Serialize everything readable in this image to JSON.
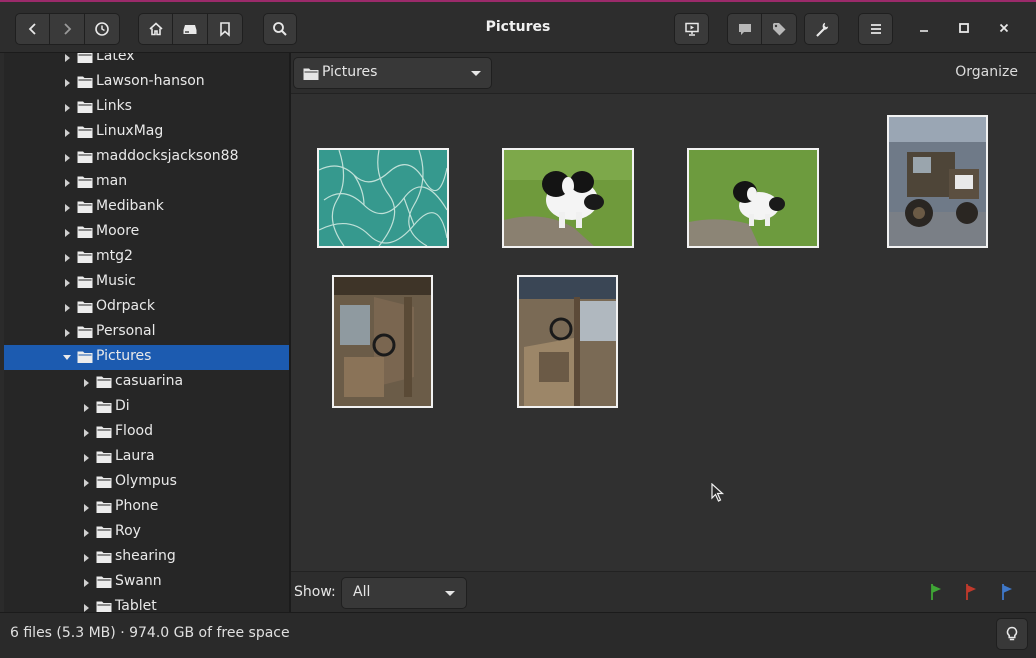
{
  "window": {
    "title": "Pictures"
  },
  "header": {
    "icons": [
      "back-icon",
      "forward-icon",
      "history-icon",
      "home-icon",
      "drive-icon",
      "bookmark-icon",
      "search-icon",
      "slideshow-icon",
      "comment-icon",
      "tag-icon",
      "tools-icon",
      "menu-icon",
      "minimize-icon",
      "maximize-icon",
      "close-icon"
    ]
  },
  "sidebar": {
    "items": [
      {
        "label": "Latex",
        "level": 0,
        "expanded": false,
        "selected": false
      },
      {
        "label": "Lawson-hanson",
        "level": 0,
        "expanded": false,
        "selected": false
      },
      {
        "label": "Links",
        "level": 0,
        "expanded": false,
        "selected": false
      },
      {
        "label": "LinuxMag",
        "level": 0,
        "expanded": false,
        "selected": false
      },
      {
        "label": "maddocksjackson88",
        "level": 0,
        "expanded": false,
        "selected": false
      },
      {
        "label": "man",
        "level": 0,
        "expanded": false,
        "selected": false
      },
      {
        "label": "Medibank",
        "level": 0,
        "expanded": false,
        "selected": false
      },
      {
        "label": "Moore",
        "level": 0,
        "expanded": false,
        "selected": false
      },
      {
        "label": "mtg2",
        "level": 0,
        "expanded": false,
        "selected": false
      },
      {
        "label": "Music",
        "level": 0,
        "expanded": false,
        "selected": false
      },
      {
        "label": "Odrpack",
        "level": 0,
        "expanded": false,
        "selected": false
      },
      {
        "label": "Personal",
        "level": 0,
        "expanded": false,
        "selected": false
      },
      {
        "label": "Pictures",
        "level": 0,
        "expanded": true,
        "selected": true
      },
      {
        "label": "casuarina",
        "level": 1,
        "expanded": false,
        "selected": false
      },
      {
        "label": "Di",
        "level": 1,
        "expanded": false,
        "selected": false
      },
      {
        "label": "Flood",
        "level": 1,
        "expanded": false,
        "selected": false
      },
      {
        "label": "Laura",
        "level": 1,
        "expanded": false,
        "selected": false
      },
      {
        "label": "Olympus",
        "level": 1,
        "expanded": false,
        "selected": false
      },
      {
        "label": "Phone",
        "level": 1,
        "expanded": false,
        "selected": false
      },
      {
        "label": "Roy",
        "level": 1,
        "expanded": false,
        "selected": false
      },
      {
        "label": "shearing",
        "level": 1,
        "expanded": false,
        "selected": false
      },
      {
        "label": "Swann",
        "level": 1,
        "expanded": false,
        "selected": false
      },
      {
        "label": "Tablet",
        "level": 1,
        "expanded": false,
        "selected": false
      }
    ]
  },
  "location": {
    "current": "Pictures",
    "organize_label": "Organize"
  },
  "thumbnails": [
    {
      "name": "thumbnail-pattern"
    },
    {
      "name": "thumbnail-dog-1"
    },
    {
      "name": "thumbnail-dog-2"
    },
    {
      "name": "thumbnail-truck"
    },
    {
      "name": "thumbnail-truck-cab-1"
    },
    {
      "name": "thumbnail-truck-cab-2"
    }
  ],
  "filter": {
    "show_label": "Show:",
    "selected": "All"
  },
  "flags": [
    {
      "name": "green-flag-icon",
      "color": "#3fa535"
    },
    {
      "name": "red-flag-icon",
      "color": "#c0392b"
    },
    {
      "name": "blue-flag-icon",
      "color": "#3f78c9"
    }
  ],
  "status": {
    "text": "6 files (5.3 MB) · 974.0 GB of free space"
  },
  "colors": {
    "selection": "#1c5bb0",
    "accent_line": "#9b2a6a"
  }
}
